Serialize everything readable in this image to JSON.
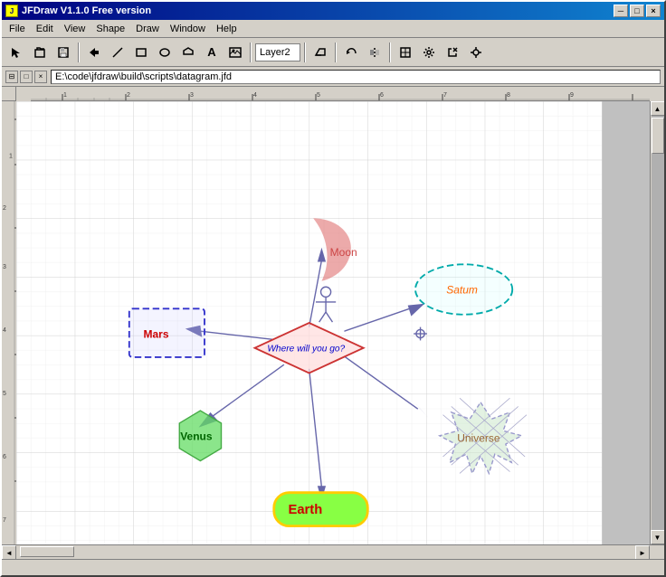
{
  "window": {
    "title": "JFDraw V1.1.0 Free version",
    "doc_path": "E:\\code\\jfdraw\\build\\scripts\\datagram.jfd"
  },
  "menu": {
    "items": [
      "File",
      "Edit",
      "View",
      "Shape",
      "Draw",
      "Window",
      "Help"
    ]
  },
  "toolbar": {
    "layer_label": "Layer2"
  },
  "title_buttons": {
    "minimize": "─",
    "maximize": "□",
    "close": "×"
  },
  "doc_controls": {
    "restore": "⧉",
    "maximize": "□",
    "close": "×"
  },
  "shapes": {
    "moon_label": "Moon",
    "mars_label": "Mars",
    "saturn_label": "Satum",
    "center_label": "Where will you go?",
    "venus_label": "Venus",
    "earth_label": "Earth",
    "universe_label": "Universe"
  },
  "colors": {
    "moon_fill": "rgba(220,100,100,0.5)",
    "mars_stroke": "#3333cc",
    "saturn_stroke": "#00cccc",
    "center_stroke": "#cc3333",
    "venus_fill": "rgba(100,220,100,0.7)",
    "earth_fill": "#88ff44",
    "earth_stroke": "#ffcc00",
    "universe_fill": "rgba(200,230,200,0.5)",
    "universe_stroke": "#9999cc",
    "arrow_color": "#6666aa",
    "mars_label_color": "#cc0000",
    "saturn_label_color": "#ff6600",
    "center_label_color": "#0000cc",
    "venus_label_color": "#006600",
    "earth_label_color": "#cc0000"
  }
}
